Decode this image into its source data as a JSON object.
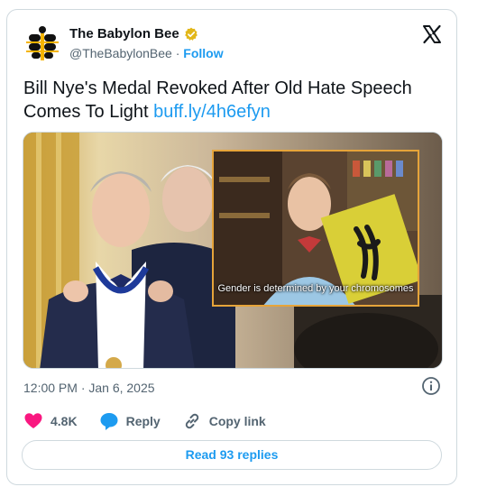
{
  "account": {
    "display_name": "The Babylon Bee",
    "handle": "@TheBabylonBee",
    "separator": " · ",
    "follow_label": "Follow"
  },
  "tweet": {
    "text": "Bill Nye's Medal Revoked After Old Hate Speech Comes To Light ",
    "link": "buff.ly/4h6efyn"
  },
  "media": {
    "caption": "Gender is determined by your chromosomes"
  },
  "meta": {
    "timestamp": "12:00 PM · Jan 6, 2025"
  },
  "actions": {
    "like_count": "4.8K",
    "reply_label": "Reply",
    "copy_link_label": "Copy link"
  },
  "replies_button": "Read 93 replies",
  "colors": {
    "accent": "#1d9bf0",
    "like": "#f91880",
    "verified": "#e2b719"
  }
}
